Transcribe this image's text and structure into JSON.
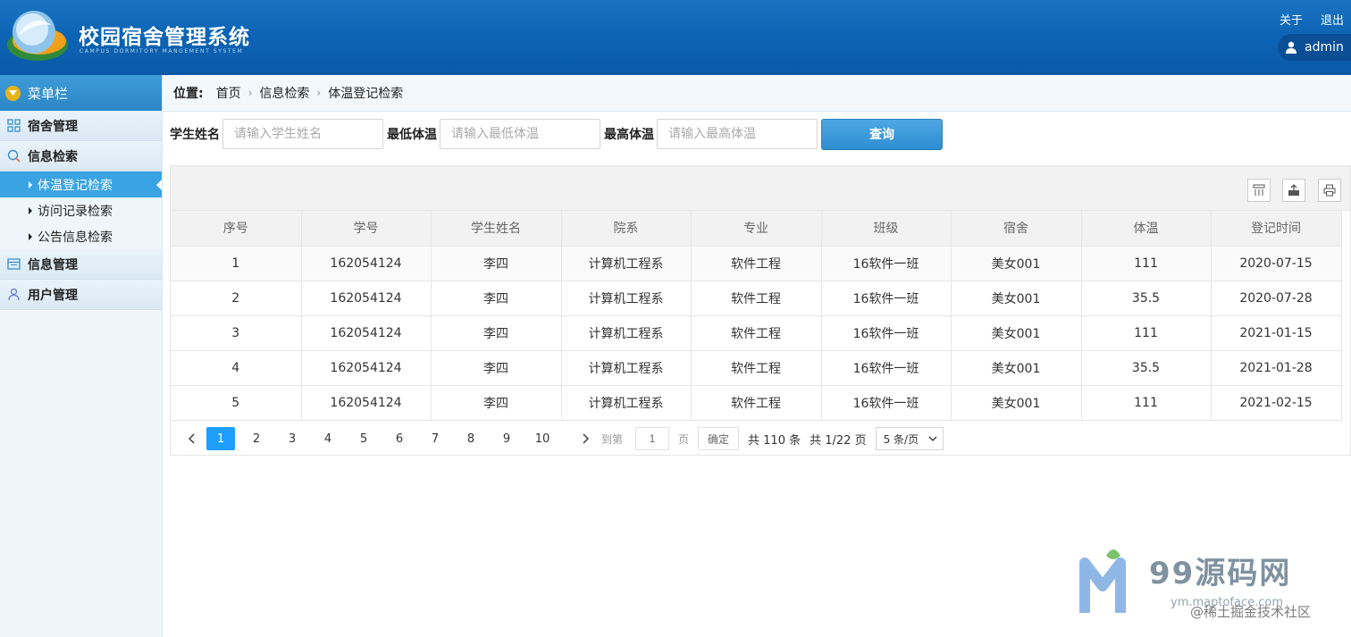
{
  "header": {
    "title": "校园宿舍管理系统",
    "subtitle": "CAMPUS DORMITORY MANGEMENT SYSTEM",
    "about_label": "关于",
    "logout_label": "退出",
    "username": "admin"
  },
  "sidebar": {
    "menu_title": "菜单栏",
    "groups": [
      {
        "label": "宿舍管理"
      },
      {
        "label": "信息检索",
        "items": [
          {
            "label": "体温登记检索",
            "active": true
          },
          {
            "label": "访问记录检索"
          },
          {
            "label": "公告信息检索"
          }
        ]
      },
      {
        "label": "信息管理"
      },
      {
        "label": "用户管理"
      }
    ]
  },
  "breadcrumb": {
    "label": "位置:",
    "items": [
      "首页",
      "信息检索",
      "体温登记检索"
    ]
  },
  "search": {
    "name_label": "学生姓名",
    "name_placeholder": "请输入学生姓名",
    "min_label": "最低体温",
    "min_placeholder": "请输入最低体温",
    "max_label": "最高体温",
    "max_placeholder": "请输入最高体温",
    "query_label": "查询"
  },
  "toolbar": {
    "icons": [
      "columns-icon",
      "export-icon",
      "print-icon"
    ]
  },
  "table": {
    "headers": [
      "序号",
      "学号",
      "学生姓名",
      "院系",
      "专业",
      "班级",
      "宿舍",
      "体温",
      "登记时间"
    ],
    "rows": [
      [
        "1",
        "162054124",
        "李四",
        "计算机工程系",
        "软件工程",
        "16软件一班",
        "美女001",
        "111",
        "2020-07-15"
      ],
      [
        "2",
        "162054124",
        "李四",
        "计算机工程系",
        "软件工程",
        "16软件一班",
        "美女001",
        "35.5",
        "2020-07-28"
      ],
      [
        "3",
        "162054124",
        "李四",
        "计算机工程系",
        "软件工程",
        "16软件一班",
        "美女001",
        "111",
        "2021-01-15"
      ],
      [
        "4",
        "162054124",
        "李四",
        "计算机工程系",
        "软件工程",
        "16软件一班",
        "美女001",
        "35.5",
        "2021-01-28"
      ],
      [
        "5",
        "162054124",
        "李四",
        "计算机工程系",
        "软件工程",
        "16软件一班",
        "美女001",
        "111",
        "2021-02-15"
      ]
    ]
  },
  "pager": {
    "pages": [
      "1",
      "2",
      "3",
      "4",
      "5",
      "6",
      "7",
      "8",
      "9",
      "10"
    ],
    "current": "1",
    "goto_label": "到第",
    "goto_value": "1",
    "page_unit": "页",
    "confirm_label": "确定",
    "total_label": "共 110 条",
    "page_count_label": "共 1/22 页",
    "per_page": "5 条/页"
  },
  "watermark": {
    "brand": "99源码网",
    "url": "ym.maptoface.com",
    "credit": "@稀土掘金技术社区"
  },
  "colors": {
    "header_bg": "#0d64b4",
    "active_item": "#3aa3e3",
    "query_button": "#2e8ed2",
    "current_page": "#1e9fff"
  }
}
